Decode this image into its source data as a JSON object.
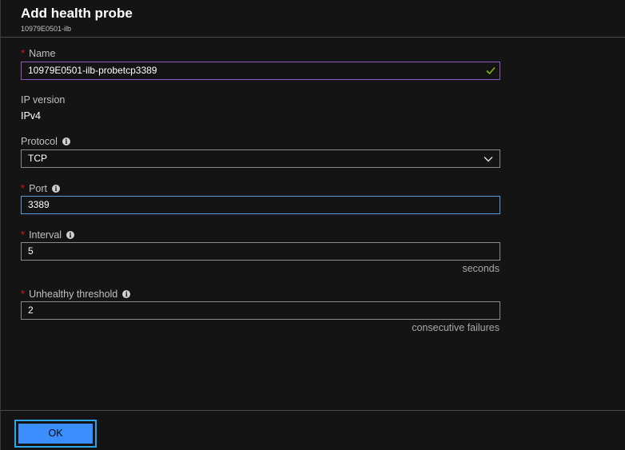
{
  "header": {
    "title": "Add health probe",
    "subtitle": "10979E0501-ilb"
  },
  "form": {
    "name": {
      "label": "Name",
      "value": "10979E0501-ilb-probetcp3389"
    },
    "ip_version": {
      "label": "IP version",
      "value": "IPv4"
    },
    "protocol": {
      "label": "Protocol",
      "value": "TCP"
    },
    "port": {
      "label": "Port",
      "value": "3389"
    },
    "interval": {
      "label": "Interval",
      "value": "5",
      "unit": "seconds"
    },
    "unhealthy_threshold": {
      "label": "Unhealthy threshold",
      "value": "2",
      "unit": "consecutive failures"
    }
  },
  "footer": {
    "ok_label": "OK"
  },
  "icons": {
    "required": "*",
    "info": "i",
    "check": "check-icon",
    "chevron": "chevron-down-icon"
  },
  "colors": {
    "background": "#141414",
    "required": "#e81123",
    "valid_check": "#7fba00",
    "focus_border": "#5a9bd5",
    "button": "#3c8eff"
  }
}
